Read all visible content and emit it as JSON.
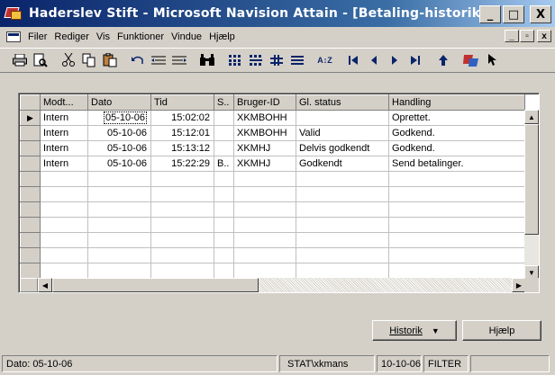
{
  "window": {
    "title": "Haderslev Stift - Microsoft Navision Attain - [Betaling-historik]",
    "minimize": "_",
    "maximize": "□",
    "close": "X"
  },
  "menu": {
    "items": [
      "Filer",
      "Rediger",
      "Vis",
      "Funktioner",
      "Vindue",
      "Hjælp"
    ],
    "mdi_minimize": "_",
    "mdi_restore": "▫",
    "mdi_close": "x"
  },
  "toolbar": {
    "icons": [
      "print-icon",
      "print-preview-icon",
      "cut-icon",
      "copy-icon",
      "paste-icon",
      "undo-icon",
      "indent-left-icon",
      "indent-right-icon",
      "find-icon",
      "grid-view-icon",
      "grid-view-2-icon",
      "plus-icon",
      "equals-icon",
      "sort-icon",
      "first-record-icon",
      "previous-record-icon",
      "next-record-icon",
      "last-record-icon",
      "up-arrow-icon",
      "navision-icon",
      "pointer-icon"
    ]
  },
  "table": {
    "columns": [
      "Modt...",
      "Dato",
      "Tid",
      "S..",
      "Bruger-ID",
      "Gl. status",
      "Handling"
    ],
    "rows": [
      [
        "Intern",
        "05-10-06",
        "15:02:02",
        "",
        "XKMBOHH",
        "",
        "Oprettet."
      ],
      [
        "Intern",
        "05-10-06",
        "15:12:01",
        "",
        "XKMBOHH",
        "Valid",
        "Godkend."
      ],
      [
        "Intern",
        "05-10-06",
        "15:13:12",
        "",
        "XKMHJ",
        "Delvis godkendt",
        "Godkend."
      ],
      [
        "Intern",
        "05-10-06",
        "15:22:29",
        "B..",
        "XKMHJ",
        "Godkendt",
        "Send betalinger."
      ]
    ],
    "empty_rows": 7
  },
  "buttons": {
    "historik": "Historik",
    "historik_arrow": "▼",
    "hjaelp": "Hjælp"
  },
  "status": {
    "date": "Dato: 05-10-06",
    "user": "STAT\\xkmans",
    "work_date": "10-10-06",
    "filter": "FILTER"
  },
  "colors": {
    "titlebar_start": "#0a246a",
    "titlebar_end": "#a6caf0",
    "face": "#d4d0c8"
  }
}
